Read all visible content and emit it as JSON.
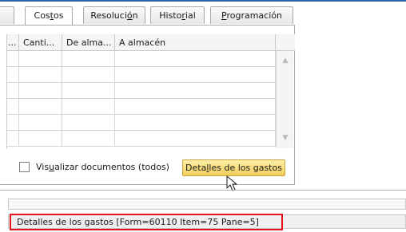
{
  "tabs": [
    {
      "pre": "Cos",
      "acc": "t",
      "post": "os",
      "active": true
    },
    {
      "pre": "Resoluci",
      "acc": "ó",
      "post": "n",
      "active": false
    },
    {
      "pre": "Histo",
      "acc": "r",
      "post": "ial",
      "active": false
    },
    {
      "pre": "",
      "acc": "P",
      "post": "rogramación",
      "active": false
    }
  ],
  "grid": {
    "headers": [
      "...",
      "Canti...",
      "De alma...",
      "A almacén"
    ],
    "rows": 6
  },
  "checkbox": {
    "pre": "Vis",
    "acc": "u",
    "post": "alizar documentos (todos)",
    "checked": false
  },
  "expenses_button": {
    "pre": "Deta",
    "acc": "l",
    "post": "les de los gastos"
  },
  "status_bar": {
    "text": "Detalles de los gastos [Form=60110 Item=75 Pane=5]"
  },
  "colors": {
    "highlight": "#e3121b",
    "button_fill": "#f2cd5a",
    "accent_line": "#2f67a8"
  },
  "icons": {
    "scroll_up": "▲",
    "scroll_down": "▼",
    "cursor": "arrow-cursor-icon"
  }
}
